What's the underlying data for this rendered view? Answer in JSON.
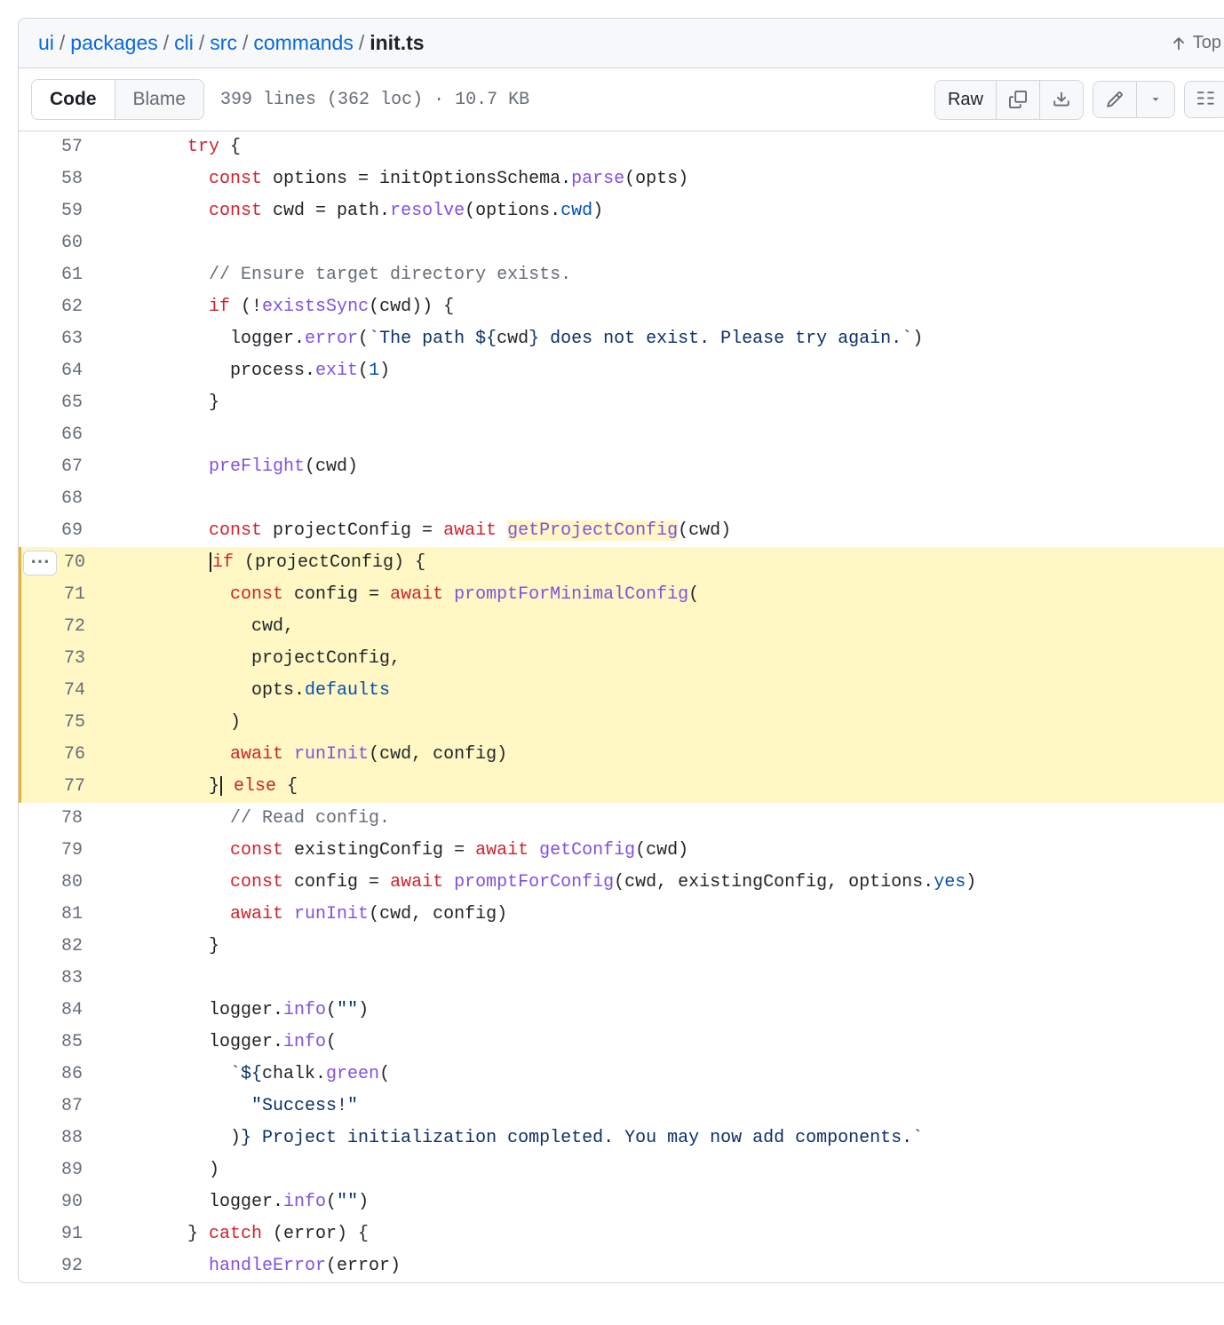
{
  "breadcrumb": {
    "parts": [
      "ui",
      "packages",
      "cli",
      "src",
      "commands"
    ],
    "current": "init.ts"
  },
  "top_button": "Top",
  "tabs": {
    "code": "Code",
    "blame": "Blame"
  },
  "file_info": "399 lines (362 loc) · 10.7 KB",
  "toolbar": {
    "raw": "Raw"
  },
  "line_start": 57,
  "ellipsis_line": 70,
  "highlighted_lines": [
    70,
    71,
    72,
    73,
    74,
    75,
    76,
    77
  ],
  "code": [
    {
      "n": 57,
      "tokens": [
        [
          "    ",
          ""
        ],
        [
          "try",
          "kw"
        ],
        [
          " {",
          ""
        ]
      ]
    },
    {
      "n": 58,
      "tokens": [
        [
          "      ",
          ""
        ],
        [
          "const",
          "kw"
        ],
        [
          " options = initOptionsSchema.",
          ""
        ],
        [
          "parse",
          "fn"
        ],
        [
          "(opts)",
          ""
        ]
      ]
    },
    {
      "n": 59,
      "tokens": [
        [
          "      ",
          ""
        ],
        [
          "const",
          "kw"
        ],
        [
          " cwd = path.",
          ""
        ],
        [
          "resolve",
          "fn"
        ],
        [
          "(options.",
          ""
        ],
        [
          "cwd",
          "prop"
        ],
        [
          ")",
          ""
        ]
      ]
    },
    {
      "n": 60,
      "tokens": [
        [
          "",
          ""
        ]
      ]
    },
    {
      "n": 61,
      "tokens": [
        [
          "      ",
          ""
        ],
        [
          "// Ensure target directory exists.",
          "cmt"
        ]
      ]
    },
    {
      "n": 62,
      "tokens": [
        [
          "      ",
          ""
        ],
        [
          "if",
          "kw"
        ],
        [
          " (!",
          ""
        ],
        [
          "existsSync",
          "fn"
        ],
        [
          "(cwd)) {",
          ""
        ]
      ]
    },
    {
      "n": 63,
      "tokens": [
        [
          "        logger.",
          ""
        ],
        [
          "error",
          "fn"
        ],
        [
          "(",
          ""
        ],
        [
          "`The path ${",
          "str"
        ],
        [
          "cwd",
          ""
        ],
        [
          "} does not exist. Please try again.`",
          "str"
        ],
        [
          ")",
          ""
        ]
      ]
    },
    {
      "n": 64,
      "tokens": [
        [
          "        process.",
          ""
        ],
        [
          "exit",
          "fn"
        ],
        [
          "(",
          ""
        ],
        [
          "1",
          "num"
        ],
        [
          ")",
          ""
        ]
      ]
    },
    {
      "n": 65,
      "tokens": [
        [
          "      }",
          ""
        ]
      ]
    },
    {
      "n": 66,
      "tokens": [
        [
          "",
          ""
        ]
      ]
    },
    {
      "n": 67,
      "tokens": [
        [
          "      ",
          ""
        ],
        [
          "preFlight",
          "fn"
        ],
        [
          "(cwd)",
          ""
        ]
      ]
    },
    {
      "n": 68,
      "tokens": [
        [
          "",
          ""
        ]
      ]
    },
    {
      "n": 69,
      "tokens": [
        [
          "      ",
          ""
        ],
        [
          "const",
          "kw"
        ],
        [
          " projectConfig = ",
          ""
        ],
        [
          "await",
          "kw"
        ],
        [
          " ",
          ""
        ],
        [
          "getProjectConfig",
          "fn-hl"
        ],
        [
          "(cwd)",
          ""
        ]
      ]
    },
    {
      "n": 70,
      "tokens": [
        [
          "      ",
          ""
        ],
        [
          "|",
          "cursor"
        ],
        [
          "if",
          "kw"
        ],
        [
          " (projectConfig) {",
          ""
        ]
      ]
    },
    {
      "n": 71,
      "tokens": [
        [
          "        ",
          ""
        ],
        [
          "const",
          "kw"
        ],
        [
          " config = ",
          ""
        ],
        [
          "await",
          "kw"
        ],
        [
          " ",
          ""
        ],
        [
          "promptForMinimalConfig",
          "fn"
        ],
        [
          "(",
          ""
        ]
      ]
    },
    {
      "n": 72,
      "tokens": [
        [
          "          cwd,",
          ""
        ]
      ]
    },
    {
      "n": 73,
      "tokens": [
        [
          "          projectConfig,",
          ""
        ]
      ]
    },
    {
      "n": 74,
      "tokens": [
        [
          "          opts.",
          ""
        ],
        [
          "defaults",
          "prop"
        ]
      ]
    },
    {
      "n": 75,
      "tokens": [
        [
          "        )",
          ""
        ]
      ]
    },
    {
      "n": 76,
      "tokens": [
        [
          "        ",
          ""
        ],
        [
          "await",
          "kw"
        ],
        [
          " ",
          ""
        ],
        [
          "runInit",
          "fn"
        ],
        [
          "(cwd, config)",
          ""
        ]
      ]
    },
    {
      "n": 77,
      "tokens": [
        [
          "      }",
          ""
        ],
        [
          "|",
          "cursor"
        ],
        [
          " ",
          ""
        ],
        [
          "else",
          "kw"
        ],
        [
          " {",
          ""
        ]
      ]
    },
    {
      "n": 78,
      "tokens": [
        [
          "        ",
          ""
        ],
        [
          "// Read config.",
          "cmt"
        ]
      ]
    },
    {
      "n": 79,
      "tokens": [
        [
          "        ",
          ""
        ],
        [
          "const",
          "kw"
        ],
        [
          " existingConfig = ",
          ""
        ],
        [
          "await",
          "kw"
        ],
        [
          " ",
          ""
        ],
        [
          "getConfig",
          "fn"
        ],
        [
          "(cwd)",
          ""
        ]
      ]
    },
    {
      "n": 80,
      "tokens": [
        [
          "        ",
          ""
        ],
        [
          "const",
          "kw"
        ],
        [
          " config = ",
          ""
        ],
        [
          "await",
          "kw"
        ],
        [
          " ",
          ""
        ],
        [
          "promptForConfig",
          "fn"
        ],
        [
          "(cwd, existingConfig, options.",
          ""
        ],
        [
          "yes",
          "prop"
        ],
        [
          ")",
          ""
        ]
      ]
    },
    {
      "n": 81,
      "tokens": [
        [
          "        ",
          ""
        ],
        [
          "await",
          "kw"
        ],
        [
          " ",
          ""
        ],
        [
          "runInit",
          "fn"
        ],
        [
          "(cwd, config)",
          ""
        ]
      ]
    },
    {
      "n": 82,
      "tokens": [
        [
          "      }",
          ""
        ]
      ]
    },
    {
      "n": 83,
      "tokens": [
        [
          "",
          ""
        ]
      ]
    },
    {
      "n": 84,
      "tokens": [
        [
          "      logger.",
          ""
        ],
        [
          "info",
          "fn"
        ],
        [
          "(",
          ""
        ],
        [
          "\"\"",
          "str"
        ],
        [
          ")",
          ""
        ]
      ]
    },
    {
      "n": 85,
      "tokens": [
        [
          "      logger.",
          ""
        ],
        [
          "info",
          "fn"
        ],
        [
          "(",
          ""
        ]
      ]
    },
    {
      "n": 86,
      "tokens": [
        [
          "        ",
          ""
        ],
        [
          "`${",
          "str"
        ],
        [
          "chalk.",
          ""
        ],
        [
          "green",
          "fn"
        ],
        [
          "(",
          ""
        ]
      ]
    },
    {
      "n": 87,
      "tokens": [
        [
          "          ",
          ""
        ],
        [
          "\"Success!\"",
          "str"
        ]
      ]
    },
    {
      "n": 88,
      "tokens": [
        [
          "        )",
          ""
        ],
        [
          "} Project initialization completed. You may now add components.`",
          "str"
        ]
      ]
    },
    {
      "n": 89,
      "tokens": [
        [
          "      )",
          ""
        ]
      ]
    },
    {
      "n": 90,
      "tokens": [
        [
          "      logger.",
          ""
        ],
        [
          "info",
          "fn"
        ],
        [
          "(",
          ""
        ],
        [
          "\"\"",
          "str"
        ],
        [
          ")",
          ""
        ]
      ]
    },
    {
      "n": 91,
      "tokens": [
        [
          "    } ",
          ""
        ],
        [
          "catch",
          "kw"
        ],
        [
          " (error) {",
          ""
        ]
      ]
    },
    {
      "n": 92,
      "tokens": [
        [
          "      ",
          ""
        ],
        [
          "handleError",
          "fn"
        ],
        [
          "(error)",
          ""
        ]
      ]
    }
  ]
}
